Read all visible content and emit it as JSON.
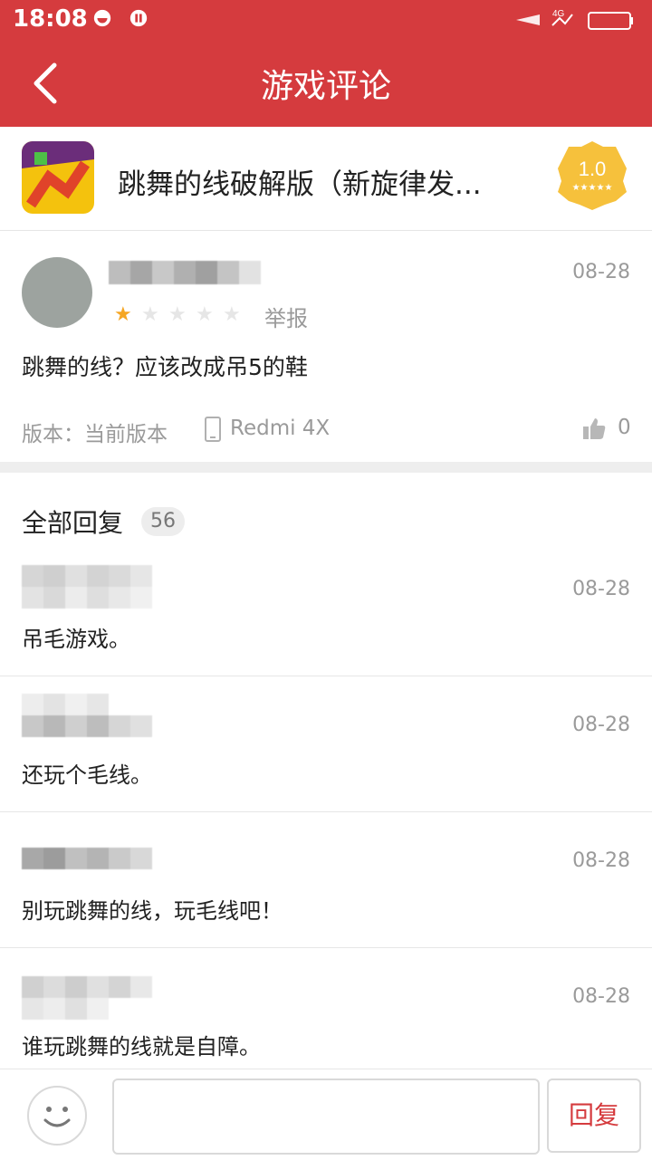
{
  "status": {
    "time": "18:08"
  },
  "header": {
    "title": "游戏评论"
  },
  "game": {
    "title": "跳舞的线破解版（新旋律发...",
    "score": "1.0"
  },
  "review": {
    "date": "08-28",
    "rating": 1,
    "report": "举报",
    "text": "跳舞的线？应该改成吊5的鞋",
    "version": "版本：当前版本",
    "device": "Redmi 4X",
    "likes": "0"
  },
  "replies_section": {
    "title": "全部回复",
    "count": "56"
  },
  "replies": [
    {
      "date": "08-28",
      "text": "吊毛游戏。"
    },
    {
      "date": "08-28",
      "text": "还玩个毛线。"
    },
    {
      "date": "08-28",
      "text": "别玩跳舞的线，玩毛线吧！"
    },
    {
      "date": "08-28",
      "text": "谁玩跳舞的线就是自障。"
    }
  ],
  "bottom": {
    "reply_button": "回复",
    "input_placeholder": ""
  },
  "colors": {
    "brand_red": "#d53b3e",
    "star_yellow": "#f5a623",
    "score_badge": "#f6c13c"
  }
}
